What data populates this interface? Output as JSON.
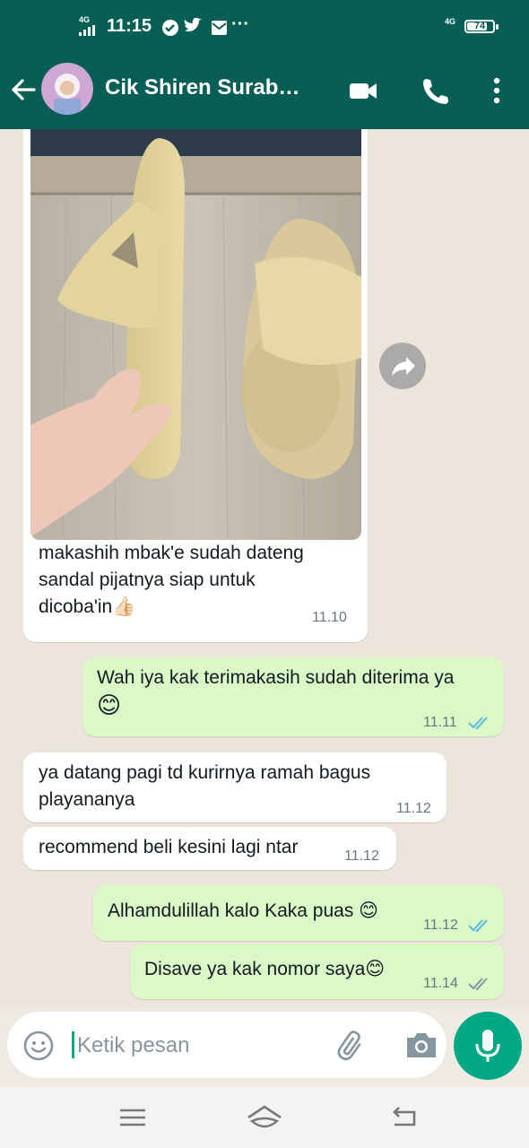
{
  "status_bar": {
    "network_left": "4G",
    "time": "11:15",
    "network_right": "4G",
    "battery_level": 74,
    "battery_label": "74",
    "more": "···"
  },
  "header": {
    "contact_name": "Cik Shiren Surab…",
    "accent": "#075e54"
  },
  "messages": [
    {
      "direction": "incoming",
      "has_image": true,
      "text": "makashih mbak'e sudah dateng sandal pijatnya siap untuk dicoba'in👍🏻",
      "lines": [
        "makashih mbak'e sudah dateng",
        "sandal pijatnya siap untuk",
        "dicoba'in👍🏻"
      ],
      "time": "11.10"
    },
    {
      "direction": "outgoing",
      "lines": [
        "Wah iya kak terimakasih sudah diterima ya",
        "😊"
      ],
      "time": "11.11",
      "status": "read"
    },
    {
      "direction": "incoming",
      "lines": [
        "ya datang pagi td kurirnya ramah bagus",
        "playananya"
      ],
      "time": "11.12"
    },
    {
      "direction": "incoming",
      "lines": [
        "recommend beli kesini lagi ntar"
      ],
      "time": "11.12"
    },
    {
      "direction": "outgoing",
      "lines": [
        "Alhamdulillah kalo Kaka puas 😊"
      ],
      "time": "11.12",
      "status": "read"
    },
    {
      "direction": "outgoing",
      "lines": [
        "Disave ya kak nomor saya😊"
      ],
      "time": "11.14",
      "status": "delivered"
    }
  ],
  "input": {
    "placeholder": "Ketik pesan"
  },
  "colors": {
    "incoming_bubble": "#ffffff",
    "outgoing_bubble": "#dcf8c6",
    "read_ticks": "#53bdeb",
    "mic_button": "#00a884"
  }
}
